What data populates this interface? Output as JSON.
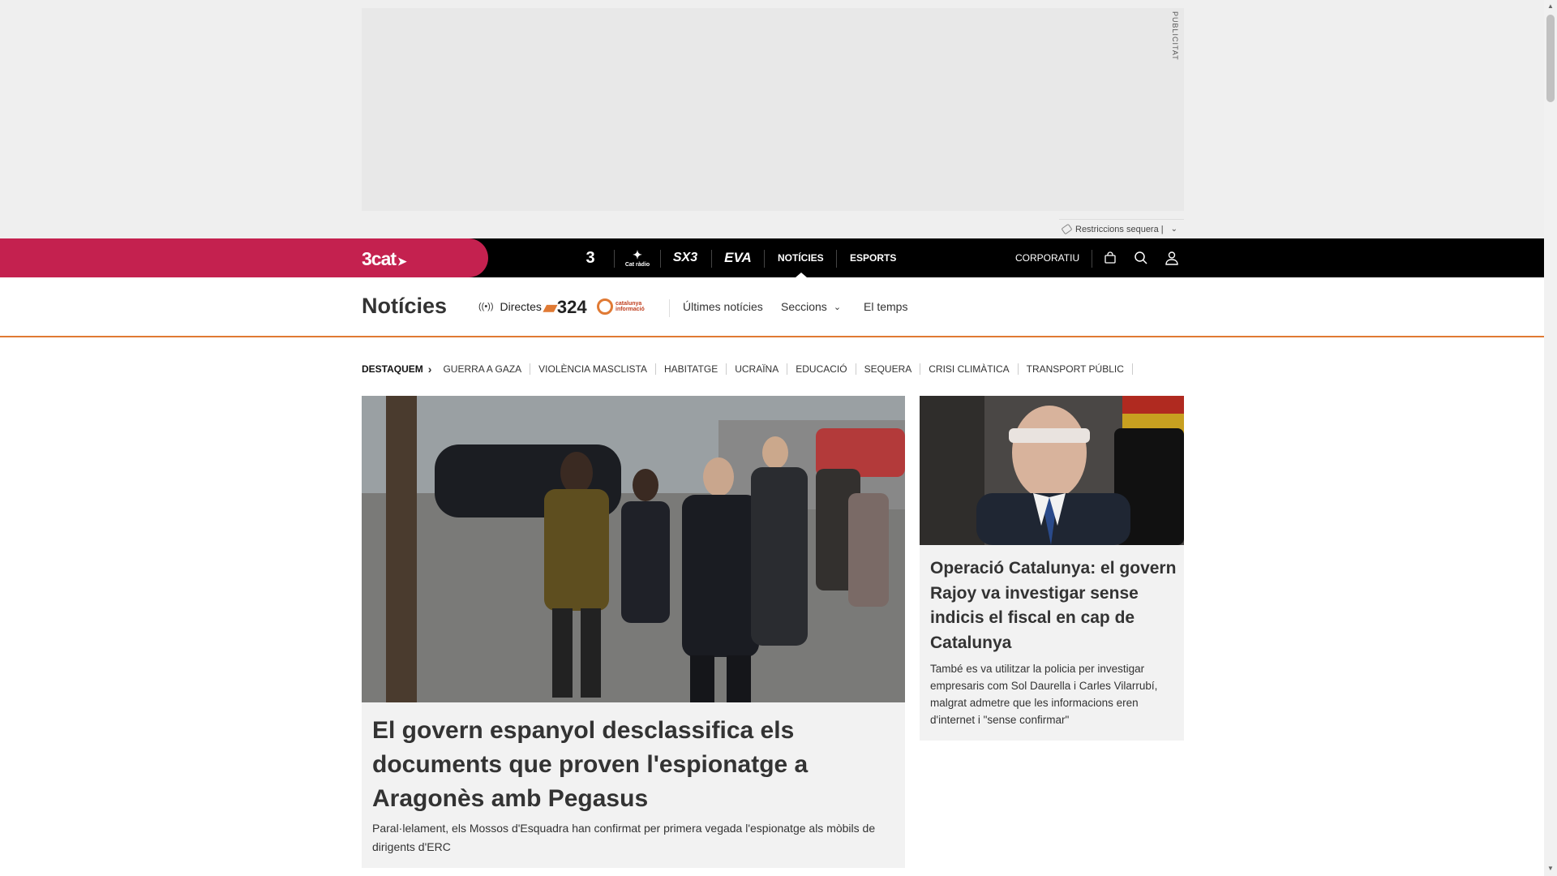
{
  "ad": {
    "label": "PUBLICITAT"
  },
  "drought": {
    "label": "Restriccions sequera |",
    "chevron_icon": "chevron-down-icon"
  },
  "topbar": {
    "logo": "3cat",
    "channels": [
      {
        "name": "3-logo",
        "label": "3"
      },
      {
        "name": "catradio-logo",
        "label": "Cat ràdio"
      },
      {
        "name": "sx3-logo",
        "label": "SX3"
      },
      {
        "name": "eva-logo",
        "label": "EVA"
      }
    ],
    "nav": {
      "noticies": "NOTÍCIES",
      "esports": "ESPORTS"
    },
    "corporatiu": "CORPORATIU",
    "icons": [
      "bag-icon",
      "search-icon",
      "user-icon"
    ],
    "colors": {
      "brand": "#c4214f",
      "bar": "#000000"
    }
  },
  "section": {
    "title": "Notícies",
    "directes": "Directes",
    "logo_324": "324",
    "logo_catinfo": "catalunya informació",
    "nav": {
      "ultimes": "Últimes notícies",
      "seccions": "Seccions",
      "temps": "El temps"
    },
    "accent": "#e07a34"
  },
  "tags": {
    "label": "DESTAQUEM",
    "items": [
      "GUERRA A GAZA",
      "VIOLÈNCIA MASCLISTA",
      "HABITATGE",
      "UCRAÏNA",
      "EDUCACIÓ",
      "SEQUERA",
      "CRISI CLIMÀTICA",
      "TRANSPORT PÚBLIC"
    ]
  },
  "main_article": {
    "title": "El govern espanyol desclassifica els documents que proven l'espionatge a Aragonès amb Pegasus",
    "subtitle": "Paral·lelament, els Mossos d'Esquadra han confirmat per primera vegada l'espionatge als mòbils de dirigents d'ERC"
  },
  "side_article": {
    "title": "Operació Catalunya: el govern Rajoy va investigar sense indicis el fiscal en cap de Catalunya",
    "subtitle": "També es va utilitzar la policia per investigar empresaris com Sol Daurella i Carles Vilarrubí, malgrat admetre que les informacions eren d'internet i \"sense confirmar\""
  }
}
